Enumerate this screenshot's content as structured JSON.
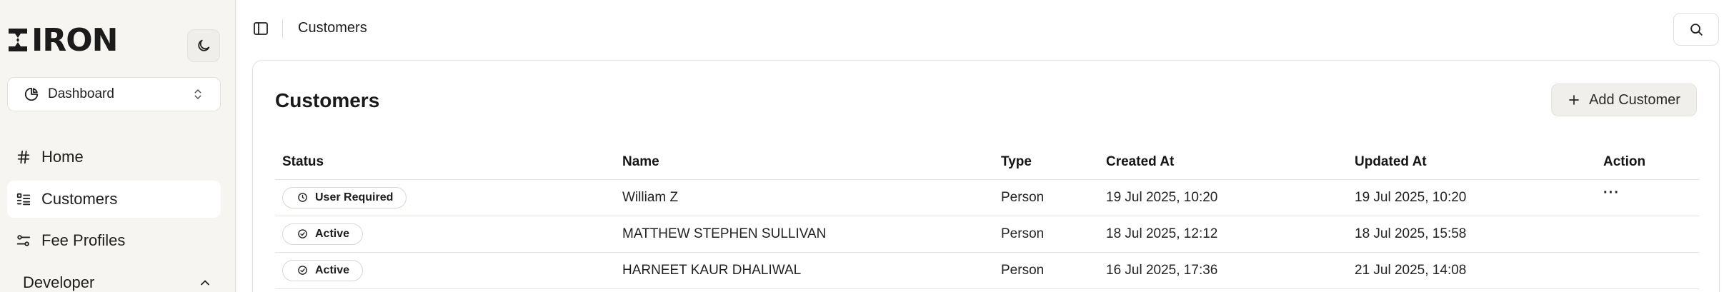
{
  "brand": {
    "logo_text": "IRON"
  },
  "sidebar": {
    "theme_toggle_icon": "moon-icon",
    "dashboard_select": {
      "icon": "pie-chart-icon",
      "label": "Dashboard",
      "chevron_icon": "chevrons-up-down-icon"
    },
    "items": [
      {
        "icon": "hash-icon",
        "label": "Home"
      },
      {
        "icon": "list-icon",
        "label": "Customers",
        "active": true
      },
      {
        "icon": "sliders-icon",
        "label": "Fee Profiles"
      }
    ],
    "section": {
      "label": "Developer",
      "chevron_icon": "chevron-up-icon"
    }
  },
  "topbar": {
    "panel_toggle_icon": "sidebar-toggle-icon",
    "breadcrumb": "Customers",
    "search_icon": "search-icon"
  },
  "main": {
    "title": "Customers",
    "add_button": {
      "icon": "plus-icon",
      "label": "Add Customer"
    },
    "table": {
      "columns": [
        "Status",
        "Name",
        "Type",
        "Created At",
        "Updated At",
        "Action"
      ],
      "rows": [
        {
          "status": "User Required",
          "status_icon": "clock-icon",
          "name": "William Z",
          "type": "Person",
          "created": "19 Jul 2025, 10:20",
          "updated": "19 Jul 2025, 10:20",
          "action": "···"
        },
        {
          "status": "Active",
          "status_icon": "check-circle-icon",
          "name": "MATTHEW STEPHEN SULLIVAN",
          "type": "Person",
          "created": "18 Jul 2025, 12:12",
          "updated": "18 Jul 2025, 15:58",
          "action": ""
        },
        {
          "status": "Active",
          "status_icon": "check-circle-icon",
          "name": "HARNEET KAUR DHALIWAL",
          "type": "Person",
          "created": "16 Jul 2025, 17:36",
          "updated": "21 Jul 2025, 14:08",
          "action": ""
        }
      ]
    }
  }
}
